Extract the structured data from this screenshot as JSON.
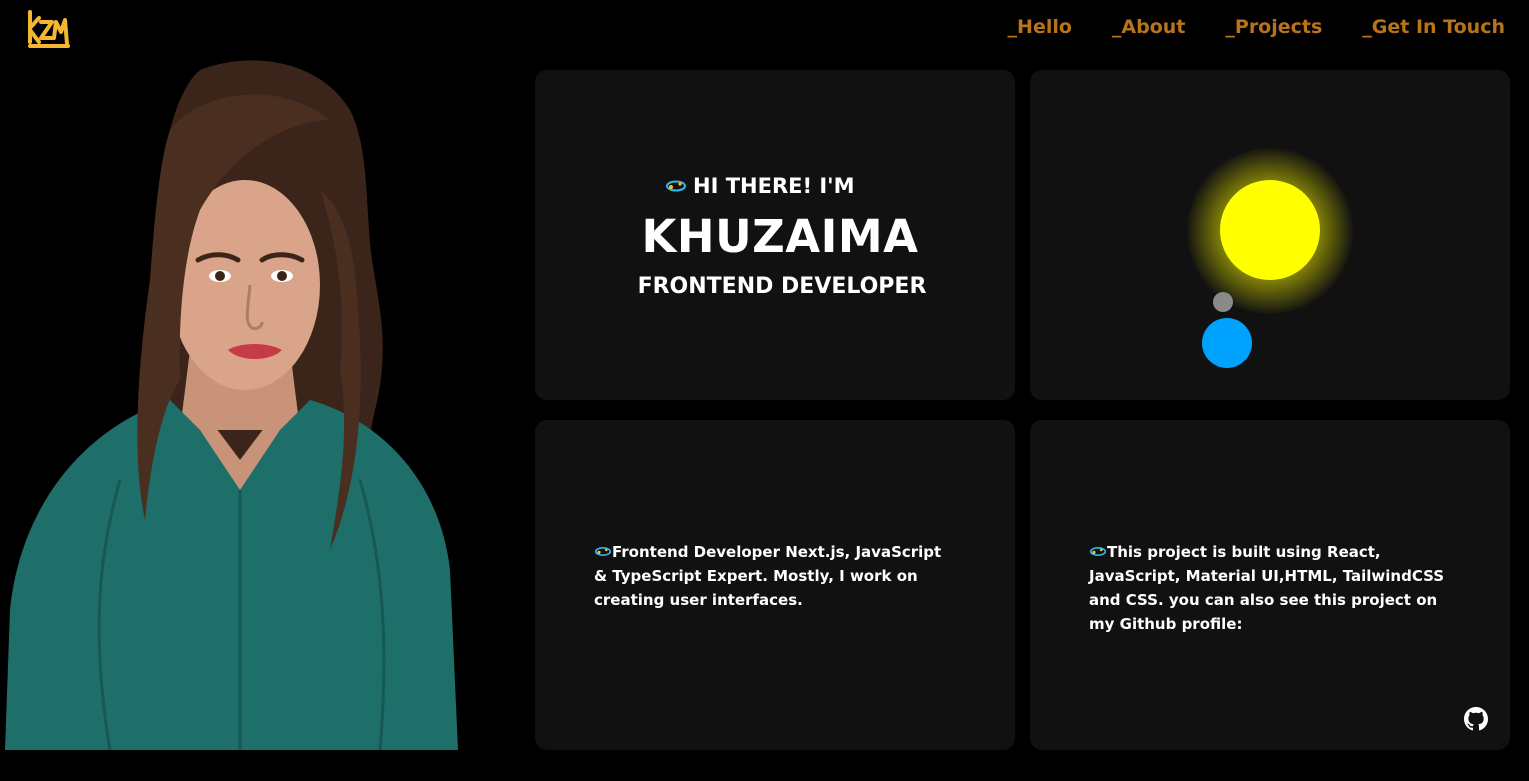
{
  "header": {
    "logo_text": "KZM",
    "nav": [
      {
        "label": "_Hello"
      },
      {
        "label": "_About"
      },
      {
        "label": "_Projects"
      },
      {
        "label": "_Get In Touch"
      }
    ]
  },
  "hero": {
    "greeting": "HI THERE! I'M",
    "name": "KHUZAIMA",
    "role": "FRONTEND DEVELOPER"
  },
  "about_card": {
    "text": "Frontend Developer Next.js, JavaScript & TypeScript Expert. Mostly, I work on creating user interfaces."
  },
  "project_card": {
    "text": "This project is built using React, JavaScript, Material UI,HTML, TailwindCSS and CSS. you can also see this project on my Github profile:"
  },
  "colors": {
    "background": "#000000",
    "card": "#111111",
    "nav_accent": "#b8741a",
    "logo": "#f5b731",
    "sun": "#ffff00",
    "moon": "#8a8a8a",
    "earth": "#00a2ff"
  },
  "icons": [
    "kzm-logo-icon",
    "sparkle-emoji-icon",
    "github-icon"
  ]
}
